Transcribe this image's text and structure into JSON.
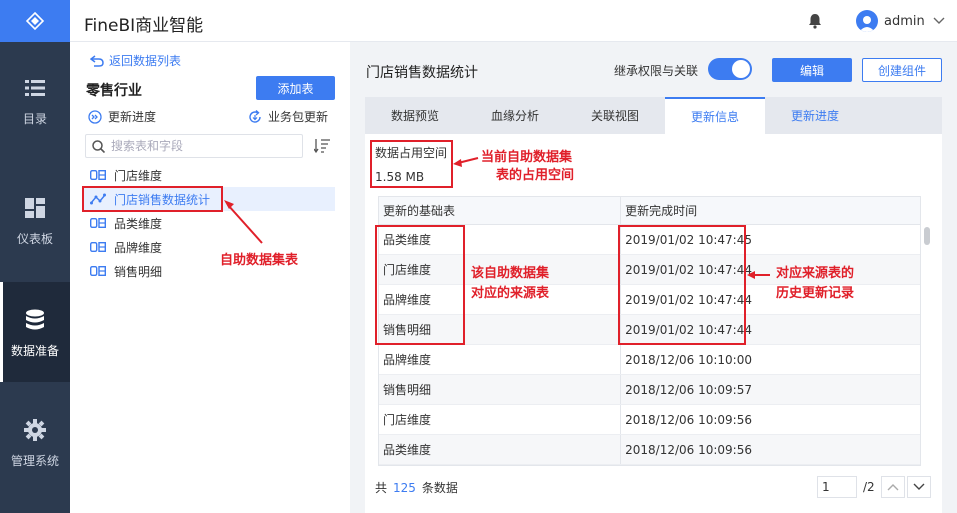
{
  "app": {
    "title": "FineBI商业智能"
  },
  "header": {
    "username": "admin"
  },
  "nav": {
    "items": [
      {
        "label": "目录",
        "icon": "list-icon",
        "active": false
      },
      {
        "label": "仪表板",
        "icon": "dashboard-icon",
        "active": false
      },
      {
        "label": "数据准备",
        "icon": "database-icon",
        "active": true
      },
      {
        "label": "管理系统",
        "icon": "gear-icon",
        "active": false
      }
    ]
  },
  "leftpanel": {
    "back_label": "返回数据列表",
    "package_title": "零售行业",
    "add_table_label": "添加表",
    "progress_label": "更新进度",
    "package_update_label": "业务包更新",
    "search_placeholder": "搜索表和字段",
    "tree": [
      {
        "label": "门店维度",
        "icon": "table-icon",
        "selected": false
      },
      {
        "label": "门店销售数据统计",
        "icon": "self-dataset-icon",
        "selected": true
      },
      {
        "label": "品类维度",
        "icon": "table-icon",
        "selected": false
      },
      {
        "label": "品牌维度",
        "icon": "table-icon",
        "selected": false
      },
      {
        "label": "销售明细",
        "icon": "table-icon",
        "selected": false
      }
    ]
  },
  "main": {
    "title": "门店销售数据统计",
    "inherit_label": "继承权限与关联",
    "inherit_on": true,
    "edit_label": "编辑",
    "create_label": "创建组件",
    "tabs": [
      {
        "label": "数据预览",
        "active": false
      },
      {
        "label": "血缘分析",
        "active": false
      },
      {
        "label": "关联视图",
        "active": false
      },
      {
        "label": "更新信息",
        "active": true
      },
      {
        "label": "更新进度",
        "active": false
      }
    ],
    "space_label": "数据占用空间",
    "space_value": "1.58 MB",
    "table": {
      "headers": [
        "更新的基础表",
        "更新完成时间"
      ],
      "rows": [
        [
          "品类维度",
          "2019/01/02 10:47:45"
        ],
        [
          "门店维度",
          "2019/01/02 10:47:44"
        ],
        [
          "品牌维度",
          "2019/01/02 10:47:44"
        ],
        [
          "销售明细",
          "2019/01/02 10:47:44"
        ],
        [
          "品牌维度",
          "2018/12/06 10:10:00"
        ],
        [
          "销售明细",
          "2018/12/06 10:09:57"
        ],
        [
          "门店维度",
          "2018/12/06 10:09:56"
        ],
        [
          "品类维度",
          "2018/12/06 10:09:56"
        ]
      ]
    },
    "footer": {
      "prefix": "共",
      "count": "125",
      "suffix": "条数据"
    },
    "pager": {
      "current": "1",
      "total": "/2"
    }
  },
  "annotations": {
    "dataset_note": "自助数据集表",
    "space_note_line1": "当前自助数据集",
    "space_note_line2": "表的占用空间",
    "source_note_line1": "该自助数据集",
    "source_note_line2": "对应的来源表",
    "history_note_line1": "对应来源表的",
    "history_note_line2": "历史更新记录"
  },
  "colors": {
    "accent": "#3d7cf1",
    "nav_bg": "#2c3a4f",
    "annotation": "#e0202a"
  }
}
